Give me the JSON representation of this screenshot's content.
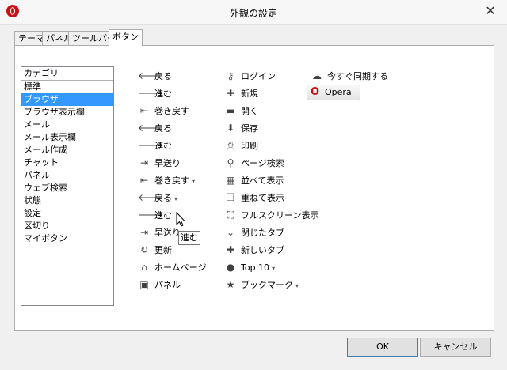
{
  "window": {
    "title": "外観の設定",
    "close_glyph": "✕",
    "accent": "#cc0f16"
  },
  "tabs": [
    "テーマ",
    "パネル",
    "ツールバー",
    "ボタン"
  ],
  "categories": [
    "カテゴリ",
    "標準",
    "ブラウザ",
    "ブラウザ表示欄",
    "メール",
    "メール表示欄",
    "メール作成",
    "チャット",
    "パネル",
    "ウェブ検索",
    "状態",
    "設定",
    "区切り",
    "マイボタン"
  ],
  "selected_category": "ブラウザ",
  "buttons_col1": [
    {
      "label": "戻る",
      "icon": "arrow-left-icon",
      "glyph": "🡐"
    },
    {
      "label": "進む",
      "icon": "arrow-right-icon",
      "glyph": "🡒"
    },
    {
      "label": "巻き戻す",
      "icon": "rewind-icon",
      "glyph": "⇤"
    },
    {
      "label": "戻る",
      "icon": "arrow-left-icon",
      "glyph": "🡐"
    },
    {
      "label": "進む",
      "icon": "arrow-right-icon",
      "glyph": "🡒"
    },
    {
      "label": "早送り",
      "icon": "fast-forward-icon",
      "glyph": "⇥"
    },
    {
      "label": "巻き戻す",
      "icon": "rewind-icon",
      "glyph": "⇤",
      "dropdown": true
    },
    {
      "label": "戻る",
      "icon": "arrow-left-icon",
      "glyph": "🡐",
      "dropdown": true
    },
    {
      "label": "進む",
      "icon": "arrow-right-icon",
      "glyph": "🡒"
    },
    {
      "label": "早送り",
      "icon": "fast-forward-icon",
      "glyph": "⇥"
    },
    {
      "label": "更新",
      "icon": "reload-icon",
      "glyph": "↻"
    },
    {
      "label": "ホームページ",
      "icon": "home-icon",
      "glyph": "⌂"
    },
    {
      "label": "パネル",
      "icon": "panel-icon",
      "glyph": "▣"
    }
  ],
  "buttons_col2": [
    {
      "label": "ログイン",
      "icon": "key-icon",
      "glyph": "⚷"
    },
    {
      "label": "新規",
      "icon": "plus-icon",
      "glyph": "✚"
    },
    {
      "label": "開く",
      "icon": "folder-icon",
      "glyph": "▬"
    },
    {
      "label": "保存",
      "icon": "save-icon",
      "glyph": "⬇"
    },
    {
      "label": "印刷",
      "icon": "printer-icon",
      "glyph": "⎙"
    },
    {
      "label": "ページ検索",
      "icon": "search-icon",
      "glyph": "⚲"
    },
    {
      "label": "並べて表示",
      "icon": "tile-icon",
      "glyph": "▦"
    },
    {
      "label": "重ねて表示",
      "icon": "cascade-icon",
      "glyph": "❐"
    },
    {
      "label": "フルスクリーン表示",
      "icon": "fullscreen-icon",
      "glyph": "⛶"
    },
    {
      "label": "閉じたタブ",
      "icon": "chevron-down-icon",
      "glyph": "⌄"
    },
    {
      "label": "新しいタブ",
      "icon": "plus-icon",
      "glyph": "✚"
    },
    {
      "label": "Top 10",
      "icon": "medal-icon",
      "glyph": "●",
      "dropdown": true
    },
    {
      "label": "ブックマーク",
      "icon": "star-icon",
      "glyph": "★",
      "dropdown": true
    }
  ],
  "buttons_col3": [
    {
      "label": "今すぐ同期する",
      "icon": "cloud-icon",
      "glyph": "☁"
    }
  ],
  "opera_button": {
    "label": "Opera",
    "logo": "O"
  },
  "tooltip": "進む",
  "dropdown_caret": "▾",
  "footer": {
    "ok": "OK",
    "cancel": "キャンセル"
  }
}
